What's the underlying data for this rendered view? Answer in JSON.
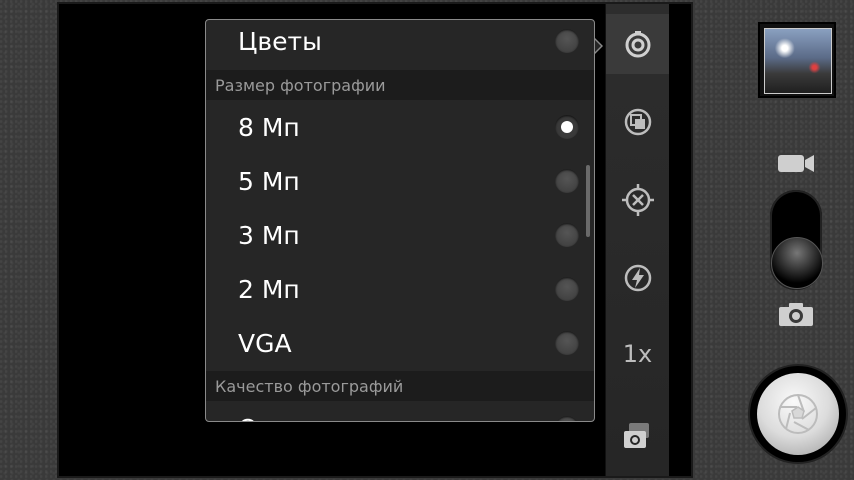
{
  "popup": {
    "top_item": {
      "label": "Цветы",
      "checked": false
    },
    "section_photo_size": "Размер фотографии",
    "sizes": [
      {
        "label": "8 Мп",
        "checked": true
      },
      {
        "label": "5 Мп",
        "checked": false
      },
      {
        "label": "3 Мп",
        "checked": false
      },
      {
        "label": "2 Мп",
        "checked": false
      },
      {
        "label": "VGA",
        "checked": false
      }
    ],
    "section_quality": "Качество фотографий",
    "partial_item": "О"
  },
  "indicators": {
    "zoom": "1x"
  },
  "icons": {
    "settings": "settings-icon",
    "image-size": "image-size-icon",
    "focus": "focus-icon",
    "flash": "flash-auto-icon",
    "camera-switch": "camera-switch-icon",
    "video-mode": "video-camera-icon",
    "photo-mode": "photo-camera-icon",
    "shutter": "aperture-icon"
  }
}
